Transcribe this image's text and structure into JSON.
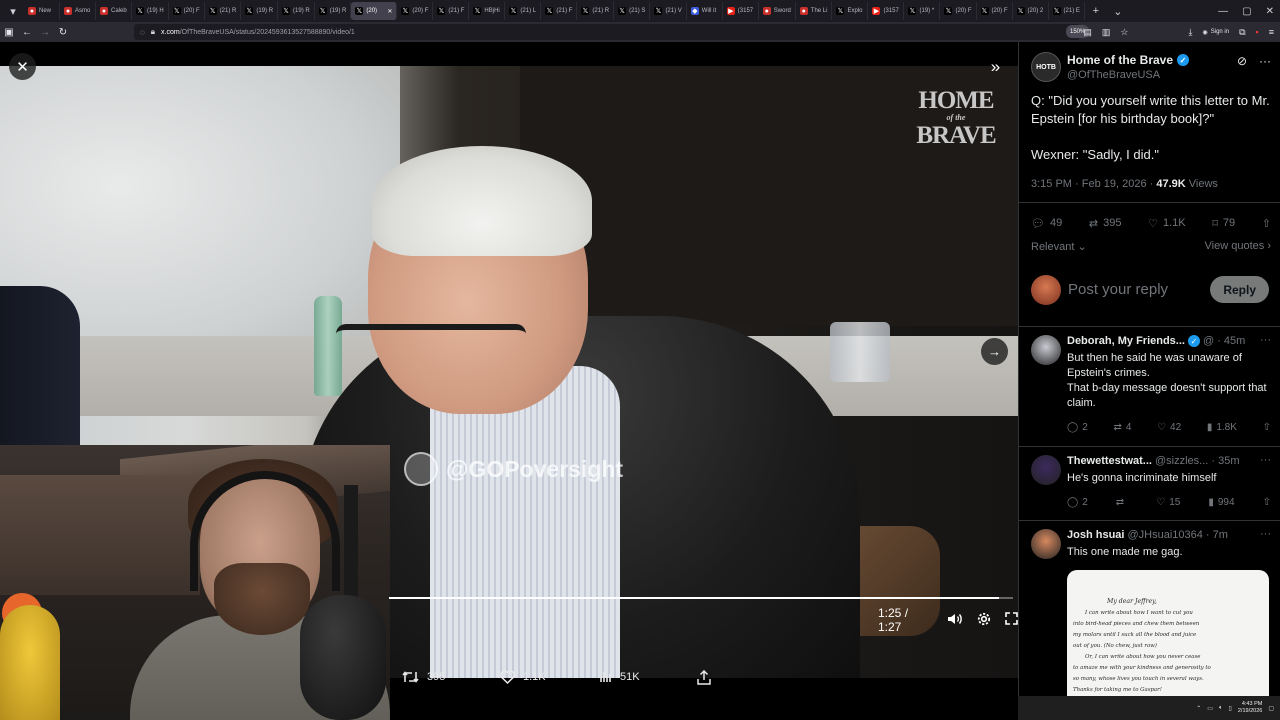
{
  "browser": {
    "tabs": [
      {
        "label": "New",
        "icon": "asmongold-icon"
      },
      {
        "label": "Asmo",
        "icon": "asmongold-icon"
      },
      {
        "label": "Caleb",
        "icon": "asmongold-icon"
      },
      {
        "label": "(19) H",
        "icon": "x-icon"
      },
      {
        "label": "(20) F",
        "icon": "x-icon"
      },
      {
        "label": "(21) R",
        "icon": "x-icon"
      },
      {
        "label": "(19) R",
        "icon": "x-icon"
      },
      {
        "label": "(19) R",
        "icon": "x-icon"
      },
      {
        "label": "(19) R",
        "icon": "x-icon"
      },
      {
        "label": "(20)",
        "icon": "x-icon",
        "active": true
      },
      {
        "label": "(20) F",
        "icon": "x-icon"
      },
      {
        "label": "(21) F",
        "icon": "x-icon"
      },
      {
        "label": "HBjHi",
        "icon": "x-icon"
      },
      {
        "label": "(21) L",
        "icon": "x-icon"
      },
      {
        "label": "(21) F",
        "icon": "x-icon"
      },
      {
        "label": "(21) R",
        "icon": "x-icon"
      },
      {
        "label": "(21) S",
        "icon": "x-icon"
      },
      {
        "label": "(21) V",
        "icon": "x-icon"
      },
      {
        "label": "Will it",
        "icon": "site-icon"
      },
      {
        "label": "(3157",
        "icon": "youtube-icon"
      },
      {
        "label": "Sword",
        "icon": "asmongold-icon"
      },
      {
        "label": "The Li",
        "icon": "asmongold-icon"
      },
      {
        "label": "Explo",
        "icon": "x-icon"
      },
      {
        "label": "(3157",
        "icon": "youtube-icon"
      },
      {
        "label": "(19) *",
        "icon": "x-icon"
      },
      {
        "label": "(20) F",
        "icon": "x-icon"
      },
      {
        "label": "(20) F",
        "icon": "x-icon"
      },
      {
        "label": "(20) 2",
        "icon": "x-icon"
      },
      {
        "label": "(21) E",
        "icon": "x-icon"
      }
    ],
    "url_host": "x.com",
    "url_path": "/OfTheBraveUSA/status/2024593613527588890/video/1",
    "zoom": "150%",
    "signin_label": "Sign in"
  },
  "video": {
    "watermark_brand_line1": "HOME",
    "watermark_brand_line2": "of the",
    "watermark_brand_line3": "BRAVE",
    "source_watermark": "@GOPoversight",
    "time": "1:25 / 1:27",
    "progress": 0.977,
    "actions": {
      "retweets": "395",
      "likes": "1.1K",
      "views": "51K"
    }
  },
  "tweet": {
    "author_name": "Home of the Brave",
    "author_handle": "@OfTheBraveUSA",
    "avatar_text": "HOTB",
    "body_line1": "Q: \"Did you yourself write this letter to Mr. Epstein [for his birthday book]?\"",
    "body_line2": "Wexner: \"Sadly, I did.\"",
    "timestamp": "3:15 PM · Feb 19, 2026 · ",
    "views_count": "47.9K",
    "views_label": " Views",
    "replies": "49",
    "retweets": "395",
    "likes": "1.1K",
    "bookmarks": "79",
    "sort_label": "Relevant",
    "view_quotes": "View quotes",
    "reply_placeholder": "Post your reply",
    "reply_button": "Reply"
  },
  "replies": [
    {
      "name": "Deborah, My Friends...",
      "handle": "@ · 45m",
      "text": "But then he said he was unaware of Epstein's crimes.\nThat b-day message doesn't support that claim.",
      "replies": "2",
      "retweets": "4",
      "likes": "42",
      "views": "1.8K",
      "avatar_color": "#c9cbd2"
    },
    {
      "name": "Thewettestwat...",
      "handle": "@sizzles... · 35m",
      "text": "He's gonna incriminate himself",
      "replies": "2",
      "retweets": "",
      "likes": "15",
      "views": "994",
      "avatar_color": "#3b2a5e"
    },
    {
      "name": "Josh hsuai",
      "handle": "@JHsuai10364 · 7m",
      "text": "This one made me gag.",
      "avatar_color": "#d7895f"
    }
  ],
  "letter": {
    "salutation": "My dear Jeffrey,",
    "lines": [
      "I can write about how I want to cut you",
      "into bird-head pieces and chew them between",
      "my molars until I suck all the blood and juice",
      "out of you. (No chew, just raw)",
      "Or, I can write about how you never cease",
      "to amaze me with your kindness and generosity to",
      "so many, whose lives you touch in several ways.",
      "Thanks for taking me to Gaspar!"
    ]
  },
  "taskbar": {
    "time": "4:43 PM",
    "date": "2/19/2026"
  }
}
